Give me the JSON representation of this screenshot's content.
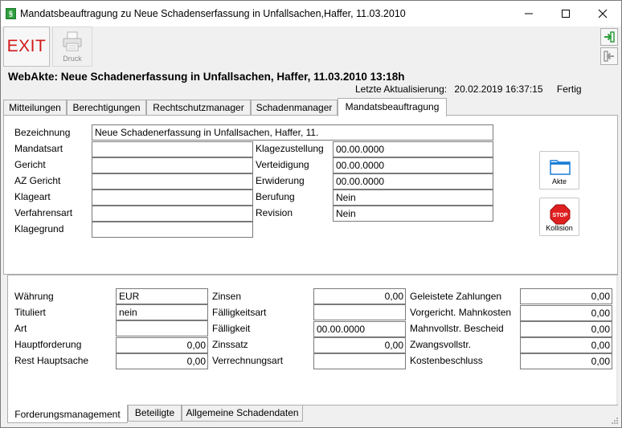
{
  "window": {
    "title": "Mandatsbeauftragung zu Neue Schadenserfassung in Unfallsachen,Haffer, 11.03.2010",
    "app_icon_glyph": "§"
  },
  "toolbar": {
    "exit_label": "EXIT",
    "print_label": "Druck"
  },
  "header": {
    "title": "WebAkte: Neue Schadenerfassung in Unfallsachen, Haffer, 11.03.2010 13:18h",
    "status_label": "Letzte Aktualisierung:",
    "status_value": "20.02.2019 16:37:15",
    "status_state": "Fertig"
  },
  "tabs_top": [
    {
      "label": "Mitteilungen"
    },
    {
      "label": "Berechtigungen"
    },
    {
      "label": "Rechtschutzmanager"
    },
    {
      "label": "Schadenmanager"
    },
    {
      "label": "Mandatsbeauftragung"
    }
  ],
  "mandat": {
    "bezeichnung": {
      "label": "Bezeichnung",
      "value": "Neue Schadenerfassung in Unfallsachen, Haffer, 11."
    },
    "mandatsart": {
      "label": "Mandatsart",
      "value": ""
    },
    "gericht": {
      "label": "Gericht",
      "value": ""
    },
    "az_gericht": {
      "label": "AZ Gericht",
      "value": ""
    },
    "klageart": {
      "label": "Klageart",
      "value": ""
    },
    "verfahrensart": {
      "label": "Verfahrensart",
      "value": ""
    },
    "klagegrund": {
      "label": "Klagegrund",
      "value": ""
    },
    "klagezustellung": {
      "label": "Klagezustellung",
      "value": "00.00.0000"
    },
    "verteidigung": {
      "label": "Verteidigung",
      "value": "00.00.0000"
    },
    "erwiderung": {
      "label": "Erwiderung",
      "value": "00.00.0000"
    },
    "berufung": {
      "label": "Berufung",
      "value": "Nein"
    },
    "revision": {
      "label": "Revision",
      "value": "Nein"
    },
    "akte_button": "Akte",
    "kollision_button": "Kollision",
    "stop_text": "STOP"
  },
  "forderung": {
    "waehrung": {
      "label": "Währung",
      "value": "EUR"
    },
    "tituliert": {
      "label": "Tituliert",
      "value": "nein"
    },
    "art": {
      "label": "Art",
      "value": ""
    },
    "hauptforderung": {
      "label": "Hauptforderung",
      "value": "0,00"
    },
    "rest_hauptsache": {
      "label": "Rest Hauptsache",
      "value": "0,00"
    },
    "zinsen": {
      "label": "Zinsen",
      "value": "0,00"
    },
    "faelligkeitsart": {
      "label": "Fälligkeitsart",
      "value": ""
    },
    "faelligkeit": {
      "label": "Fälligkeit",
      "value": "00.00.0000"
    },
    "zinssatz": {
      "label": "Zinssatz",
      "value": "0,00"
    },
    "verrechnungsart": {
      "label": "Verrechnungsart",
      "value": ""
    },
    "geleistete_zahlungen": {
      "label": "Geleistete Zahlungen",
      "value": "0,00"
    },
    "vorgericht_mahnkosten": {
      "label": "Vorgericht. Mahnkosten",
      "value": "0,00"
    },
    "mahnvollstr_bescheid": {
      "label": "Mahnvollstr. Bescheid",
      "value": "0,00"
    },
    "zwangsvollstr": {
      "label": "Zwangsvollstr.",
      "value": "0,00"
    },
    "kostenbeschluss": {
      "label": "Kostenbeschluss",
      "value": "0,00"
    }
  },
  "tabs_bottom": [
    {
      "label": "Forderungsmanagement"
    },
    {
      "label": "Beteiligte"
    },
    {
      "label": "Allgemeine Schadendaten"
    }
  ],
  "colors": {
    "exit_red": "#d11a1a",
    "app_green": "#2e9e3e",
    "folder_blue": "#1a7fd6",
    "stop_red": "#e02020"
  }
}
